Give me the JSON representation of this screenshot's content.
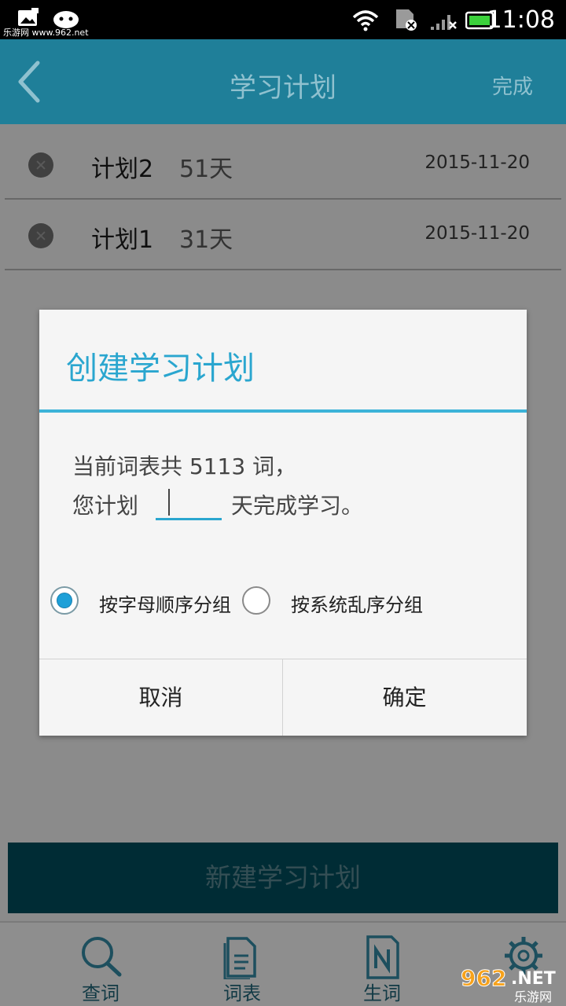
{
  "status_bar": {
    "watermark": "乐游网 www.962.net",
    "time": "11:08"
  },
  "header": {
    "title": "学习计划",
    "done_label": "完成"
  },
  "plans": [
    {
      "name": "计划2",
      "days": "51天",
      "date": "2015-11-20"
    },
    {
      "name": "计划1",
      "days": "31天",
      "date": "2015-11-20"
    }
  ],
  "dialog": {
    "title": "创建学习计划",
    "line1": "当前词表共 5113 词，",
    "line2_prefix": "您计划",
    "days_value": "",
    "line2_suffix": "天完成学习。",
    "options": [
      {
        "label": "按字母顺序分组",
        "selected": true
      },
      {
        "label": "按系统乱序分组",
        "selected": false
      }
    ],
    "cancel_label": "取消",
    "confirm_label": "确定"
  },
  "new_plan_button": "新建学习计划",
  "bottom_nav": [
    {
      "label": "查词",
      "icon": "search-icon"
    },
    {
      "label": "词表",
      "icon": "document-icon"
    },
    {
      "label": "生词",
      "icon": "notebook-icon"
    },
    {
      "label": "",
      "icon": "gear-icon"
    }
  ],
  "brand": {
    "text": "962.NET",
    "sub": "乐游网"
  },
  "colors": {
    "header": "#1f7f99",
    "accent": "#2aa6cf",
    "new_button": "#004d5c"
  }
}
